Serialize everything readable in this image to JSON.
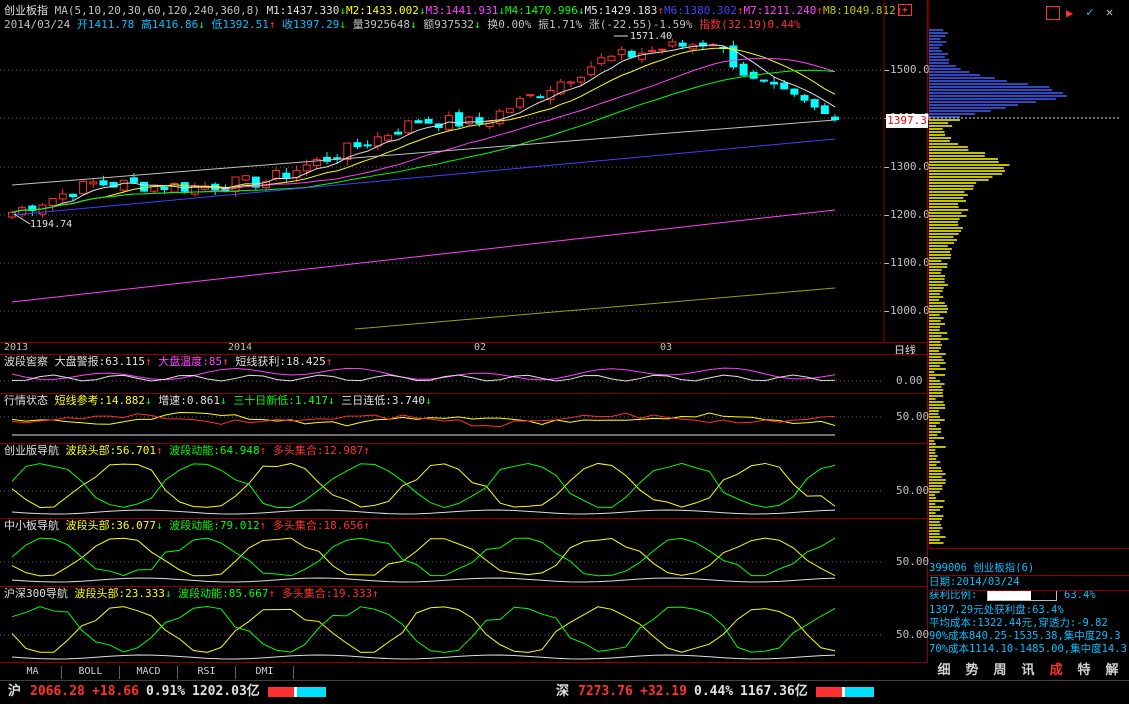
{
  "header": {
    "title": "创业板指",
    "ma_params": "MA(5,10,20,30,60,120,240,360,8)",
    "ma": [
      {
        "label": "M1:1437.330",
        "dir": "down",
        "color": "#e0e0e0"
      },
      {
        "label": "M2:1433.002",
        "dir": "down",
        "color": "#ffff00"
      },
      {
        "label": "M3:1441.931",
        "dir": "down",
        "color": "#ff40ff"
      },
      {
        "label": "M4:1470.996",
        "dir": "down",
        "color": "#00ff00"
      },
      {
        "label": "M5:1429.183",
        "dir": "up",
        "color": "#e0e0e0"
      },
      {
        "label": "M6:1380.302",
        "dir": "up",
        "color": "#4040ff"
      },
      {
        "label": "M7:1211.240",
        "dir": "up",
        "color": "#ff40ff"
      },
      {
        "label": "M8:1049.812",
        "dir": "up",
        "color": "#c0c000"
      }
    ],
    "date": "2014/03/24",
    "open": "开1411.78",
    "high": "高1416.86",
    "low": "低1392.51",
    "close": "收1397.29",
    "volume": "量3925648",
    "amount": "额937532",
    "turnover": "换0.00%",
    "amplitude": "振1.71%",
    "change": "涨(-22.55)-1.59%",
    "index_label": "指数(32.19)0.44%",
    "max_price_label": "1571.40",
    "min_price_label": "1194.74",
    "current_price": "1397.3",
    "price_ticks": [
      "1500.0",
      "1400.0",
      "1300.0",
      "1200.0",
      "1100.0",
      "1000.0"
    ],
    "x_labels": [
      "2013",
      "2014",
      "02",
      "03"
    ],
    "period": "日线"
  },
  "indicators": [
    {
      "name": "波段窖察",
      "items": [
        {
          "label": "大盘警报:63.115",
          "dir": "up",
          "color": "#e0e0e0"
        },
        {
          "label": "大盘温度:85",
          "dir": "up",
          "color": "#ff40ff"
        },
        {
          "label": "短线获利:18.425",
          "dir": "up",
          "color": "#e0e0e0"
        }
      ],
      "tick": "0.00"
    },
    {
      "name": "行情状态",
      "items": [
        {
          "label": "短线参考:14.882",
          "dir": "down",
          "color": "#ffff00"
        },
        {
          "label": "增速:0.861",
          "dir": "down",
          "color": "#e0e0e0"
        },
        {
          "label": "三十日新低:1.417",
          "dir": "down",
          "color": "#00ff00"
        },
        {
          "label": "三日连低:3.740",
          "dir": "down",
          "color": "#e0e0e0"
        }
      ],
      "tick": "50.00"
    },
    {
      "name": "创业版导航",
      "items": [
        {
          "label": "波段头部:56.701",
          "dir": "up",
          "color": "#ffff00"
        },
        {
          "label": "波段动能:64.948",
          "dir": "up",
          "color": "#00ff00"
        },
        {
          "label": "多头集合:12.987",
          "dir": "up",
          "color": "#ff3030"
        }
      ],
      "tick": "50.00"
    },
    {
      "name": "中小板导航",
      "items": [
        {
          "label": "波段头部:36.077",
          "dir": "down",
          "color": "#ffff00"
        },
        {
          "label": "波段动能:79.012",
          "dir": "up",
          "color": "#00ff00"
        },
        {
          "label": "多头集合:18.656",
          "dir": "up",
          "color": "#ff3030"
        }
      ],
      "tick": "50.00"
    },
    {
      "name": "沪深300导航",
      "items": [
        {
          "label": "波段头部:23.333",
          "dir": "down",
          "color": "#ffff00"
        },
        {
          "label": "波段动能:85.667",
          "dir": "up",
          "color": "#00ff00"
        },
        {
          "label": "多头集合:19.333",
          "dir": "up",
          "color": "#ff3030"
        }
      ],
      "tick": "50.00"
    }
  ],
  "bottom_tabs": [
    "MA",
    "BOLL",
    "MACD",
    "RSI",
    "DMI"
  ],
  "right_panel": {
    "code_name": "399006 创业板指(6)",
    "date": "日期:2014/03/24",
    "profit_ratio_label": "获利比例:",
    "profit_ratio_value": "63.4%",
    "profit_ratio": 0.634,
    "line1": "1397.29元处获利盘:63.4%",
    "line2": "平均成本:1322.44元,穿透力:-9.82",
    "line3": "90%成本840.25-1535.38,集中度29.3",
    "line4": "70%成本1114.10-1485.00,集中度14.3",
    "tabs": [
      "细",
      "势",
      "周",
      "讯",
      "成",
      "特",
      "解"
    ]
  },
  "status_bar": {
    "sh_label": "沪",
    "sh_price": "2066.28",
    "sh_change": "+18.66",
    "sh_pct": "0.91%",
    "sh_amount": "1202.03亿",
    "sz_label": "深",
    "sz_price": "7273.76",
    "sz_change": "+32.19",
    "sz_pct": "0.44%",
    "sz_amount": "1167.36亿"
  }
}
